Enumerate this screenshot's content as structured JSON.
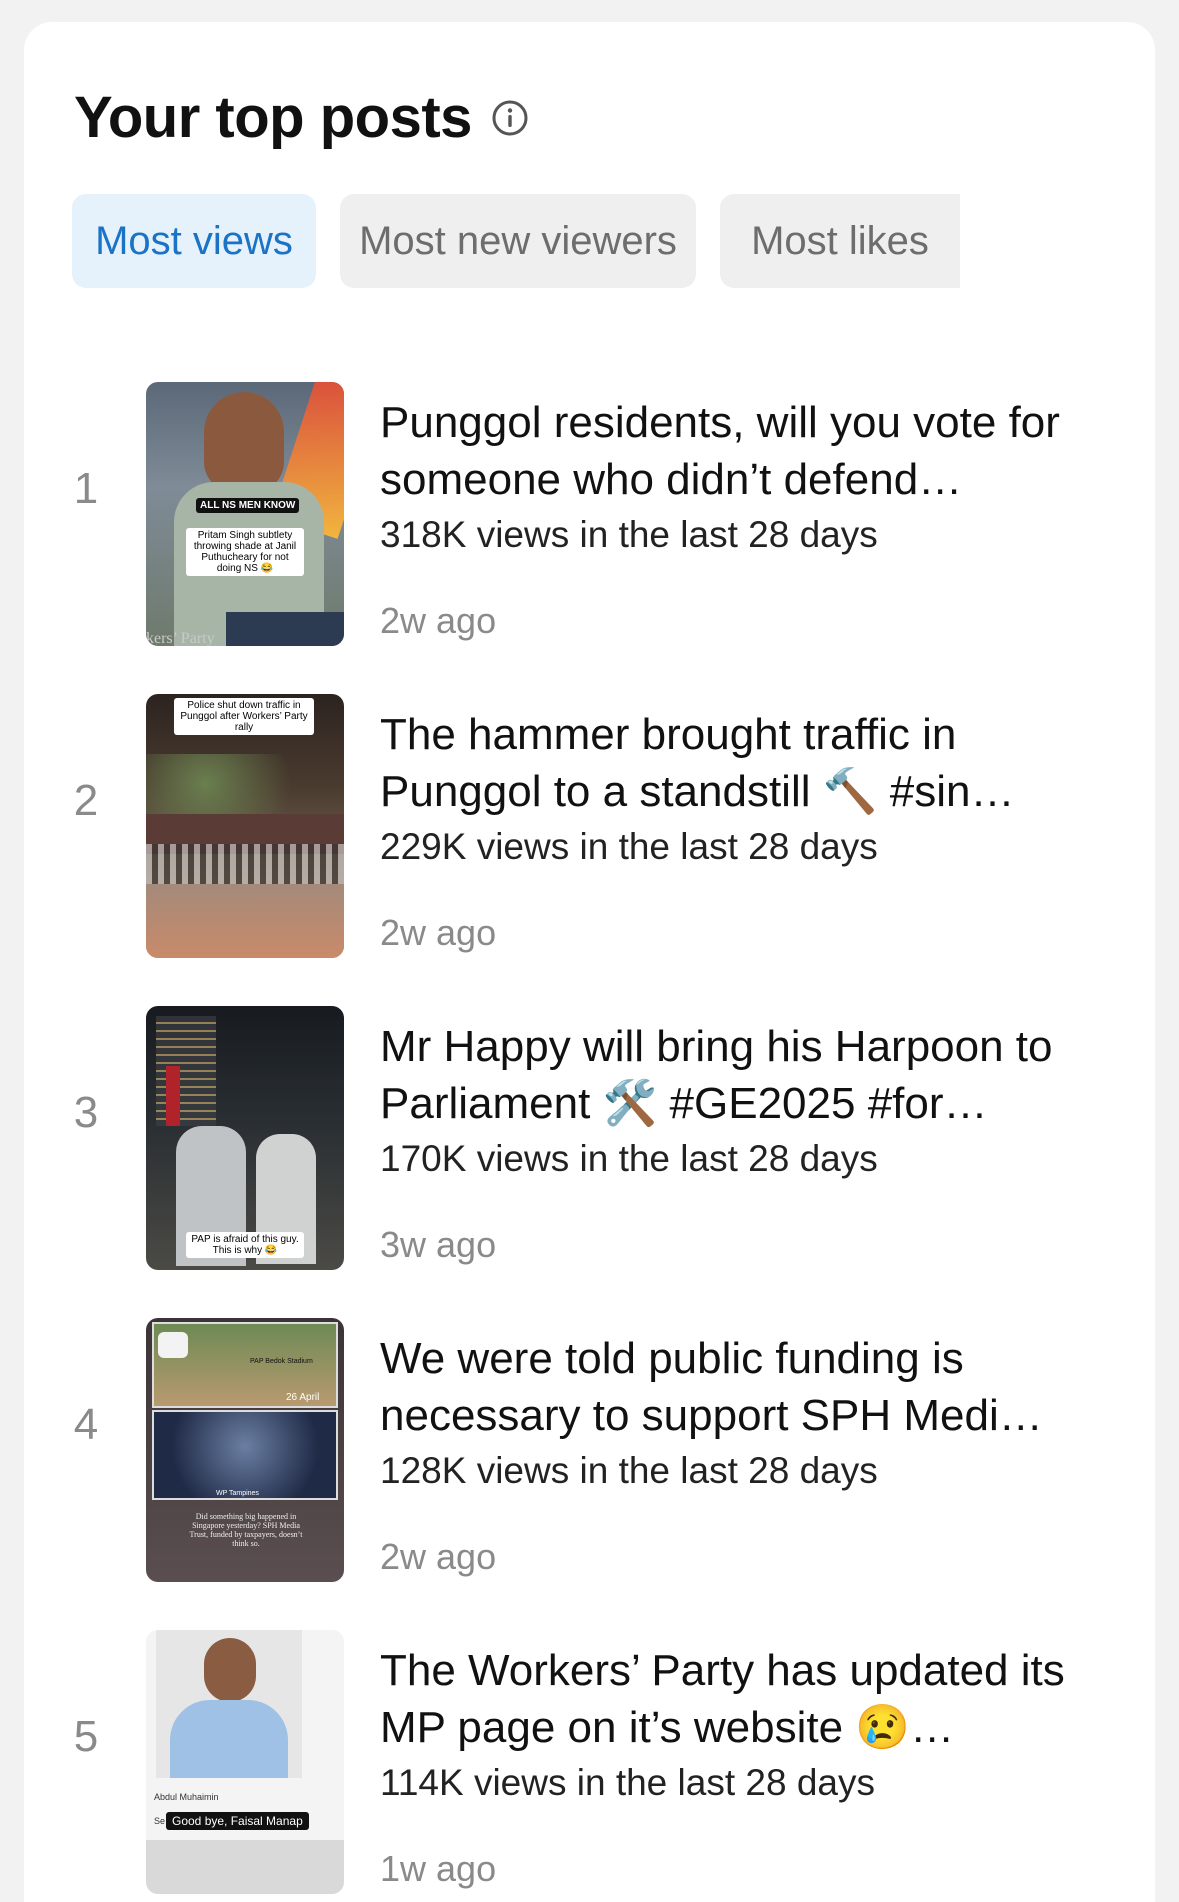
{
  "header": {
    "title": "Your top posts",
    "info_icon": "info-circle-icon"
  },
  "tabs": [
    {
      "label": "Most views",
      "active": true
    },
    {
      "label": "Most new viewers",
      "active": false
    },
    {
      "label": "Most likes",
      "active": false
    }
  ],
  "posts": [
    {
      "rank": "1",
      "title": "Punggol residents, will you vote for someone who didn’t defend…",
      "views": "318K views in the last 28 days",
      "age": "2w ago",
      "thumb_texts": [
        "ALL NS MEN KNOW",
        "Pritam Singh subtlety throwing shade at Janil Puthucheary for not doing NS 😂",
        "kers’ Party"
      ]
    },
    {
      "rank": "2",
      "title": "The hammer brought traffic in Punggol to a standstill 🔨  #sin…",
      "views": "229K views in the last 28 days",
      "age": "2w ago",
      "thumb_texts": [
        "Police shut down traffic in Punggol after Workers’ Party rally"
      ]
    },
    {
      "rank": "3",
      "title": "Mr Happy will bring his Harpoon to Parliament 🛠️ #GE2025 #for…",
      "views": "170K views in the last 28 days",
      "age": "3w ago",
      "thumb_texts": [
        "PAP is afraid of this guy. This is why 😂"
      ]
    },
    {
      "rank": "4",
      "title": "We were told public funding is necessary to support SPH Medi…",
      "views": "128K views in the last 28 days",
      "age": "2w ago",
      "thumb_texts": [
        "PAP Bedok Stadium",
        "26 April",
        "WP Tampines",
        "Did something big happened in Singapore yesterday? SPH Media Trust, funded by taxpayers, doesn’t think so."
      ]
    },
    {
      "rank": "5",
      "title": "The Workers’ Party has updated its MP page on it’s website 😢…",
      "views": "114K views in the last 28 days",
      "age": "1w ago",
      "thumb_texts": [
        "Abdul Muhaimin",
        "Se",
        "Good bye, Faisal Manap"
      ]
    }
  ],
  "colors": {
    "active_tab_bg": "#e5f1fb",
    "active_tab_text": "#1a73c6",
    "inactive_tab_bg": "#efefef",
    "inactive_tab_text": "#6d6d6d"
  }
}
